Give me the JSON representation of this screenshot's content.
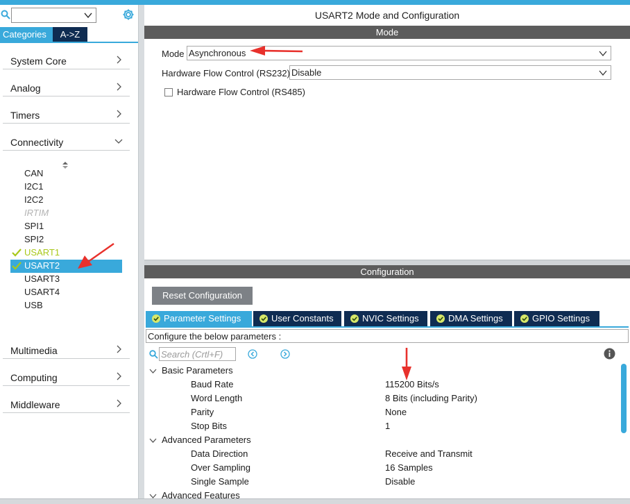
{
  "sidebar": {
    "search_combo_value": "",
    "tabs": {
      "categories": "Categories",
      "az": "A->Z"
    },
    "categories": [
      {
        "label": "System Core",
        "expanded": false
      },
      {
        "label": "Analog",
        "expanded": false
      },
      {
        "label": "Timers",
        "expanded": false
      },
      {
        "label": "Connectivity",
        "expanded": true
      },
      {
        "label": "Multimedia",
        "expanded": false
      },
      {
        "label": "Computing",
        "expanded": false
      },
      {
        "label": "Middleware",
        "expanded": false
      }
    ],
    "connectivity_items": [
      {
        "label": "CAN",
        "state": "normal"
      },
      {
        "label": "I2C1",
        "state": "normal"
      },
      {
        "label": "I2C2",
        "state": "normal"
      },
      {
        "label": "IRTIM",
        "state": "disabled"
      },
      {
        "label": "SPI1",
        "state": "normal"
      },
      {
        "label": "SPI2",
        "state": "normal"
      },
      {
        "label": "USART1",
        "state": "configured"
      },
      {
        "label": "USART2",
        "state": "selected"
      },
      {
        "label": "USART3",
        "state": "normal"
      },
      {
        "label": "USART4",
        "state": "normal"
      },
      {
        "label": "USB",
        "state": "normal"
      }
    ]
  },
  "main": {
    "title": "USART2 Mode and Configuration",
    "mode_section": {
      "header": "Mode",
      "mode_label": "Mode",
      "mode_value": "Asynchronous",
      "hw_flow_rs232_label": "Hardware Flow Control (RS232)",
      "hw_flow_rs232_value": "Disable",
      "hw_flow_rs485_label": "Hardware Flow Control (RS485)",
      "hw_flow_rs485_checked": false
    },
    "config_section": {
      "header": "Configuration",
      "reset_button": "Reset Configuration",
      "tabs": [
        {
          "label": "Parameter Settings",
          "active": true
        },
        {
          "label": "User Constants",
          "active": false
        },
        {
          "label": "NVIC Settings",
          "active": false
        },
        {
          "label": "DMA Settings",
          "active": false
        },
        {
          "label": "GPIO Settings",
          "active": false
        }
      ],
      "instruction": "Configure the below parameters :",
      "search_placeholder": "Search (Crtl+F)",
      "groups": [
        {
          "name": "Basic Parameters",
          "params": [
            {
              "name": "Baud Rate",
              "value": "115200 Bits/s"
            },
            {
              "name": "Word Length",
              "value": "8 Bits (including Parity)"
            },
            {
              "name": "Parity",
              "value": "None"
            },
            {
              "name": "Stop Bits",
              "value": "1"
            }
          ]
        },
        {
          "name": "Advanced Parameters",
          "params": [
            {
              "name": "Data Direction",
              "value": "Receive and Transmit"
            },
            {
              "name": "Over Sampling",
              "value": "16 Samples"
            },
            {
              "name": "Single Sample",
              "value": "Disable"
            }
          ]
        },
        {
          "name": "Advanced Features",
          "params": []
        }
      ]
    }
  },
  "colors": {
    "accent": "#39a9db",
    "navy": "#0f2c52",
    "header_gray": "#5c5c5c",
    "configured_green": "#a9c81a",
    "annotation_red": "#e8312c"
  },
  "icons": [
    "search-icon",
    "chevron-down-icon",
    "gear-icon",
    "chevron-right-icon",
    "sort-icon",
    "check-icon",
    "check-circle-icon",
    "arrow-left-circle-icon",
    "arrow-right-circle-icon",
    "info-icon"
  ]
}
